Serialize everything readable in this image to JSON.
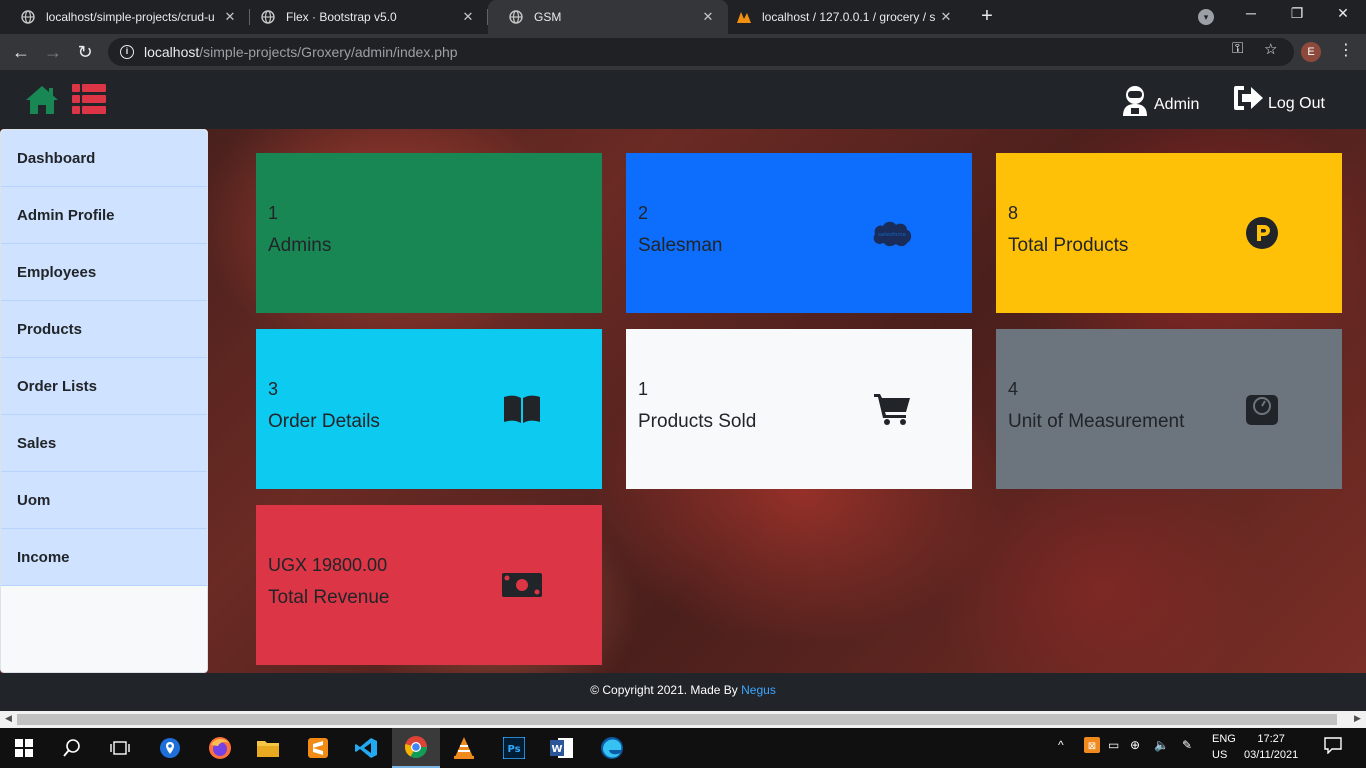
{
  "browser": {
    "tabs": [
      {
        "title": "localhost/simple-projects/crud-u",
        "icon": "globe-icon"
      },
      {
        "title": "Flex · Bootstrap v5.0",
        "icon": "globe-icon"
      },
      {
        "title": "GSM",
        "icon": "globe-icon"
      },
      {
        "title": "localhost / 127.0.0.1 / grocery / s",
        "icon": "phpmyadmin-icon"
      }
    ],
    "url_host": "localhost",
    "url_path": "/simple-projects/Groxery/admin/index.php",
    "profile_initial": "E"
  },
  "navbar": {
    "admin_label": "Admin",
    "logout_label": "Log Out",
    "home_color": "#198754",
    "list_color": "#dc3545"
  },
  "sidebar": {
    "items": [
      {
        "label": "Dashboard"
      },
      {
        "label": "Admin Profile"
      },
      {
        "label": "Employees"
      },
      {
        "label": "Products"
      },
      {
        "label": "Order Lists"
      },
      {
        "label": "Sales"
      },
      {
        "label": "Uom"
      },
      {
        "label": "Income"
      }
    ]
  },
  "cards": [
    {
      "value": "1",
      "label": "Admins",
      "bg": "#198754",
      "icon": "none"
    },
    {
      "value": "2",
      "label": "Salesman",
      "bg": "#0d6efd",
      "icon": "salesforce-icon"
    },
    {
      "value": "8",
      "label": "Total Products",
      "bg": "#ffc107",
      "icon": "product-hunt-icon"
    },
    {
      "value": "3",
      "label": "Order Details",
      "bg": "#0dcaf0",
      "icon": "book-icon"
    },
    {
      "value": "1",
      "label": "Products Sold",
      "bg": "#f8f9fa",
      "icon": "cart-icon"
    },
    {
      "value": "4",
      "label": "Unit of Measurement",
      "bg": "#6c757d",
      "icon": "weight-icon"
    },
    {
      "value": "UGX 19800.00",
      "label": "Total Revenue",
      "bg": "#dc3545",
      "icon": "money-bill-icon"
    }
  ],
  "footer": {
    "text": "© Copyright 2021. Made By",
    "link": "Negus"
  },
  "taskbar": {
    "lang_top": "ENG",
    "lang_bottom": "US",
    "time": "17:27",
    "date": "03/11/2021"
  }
}
